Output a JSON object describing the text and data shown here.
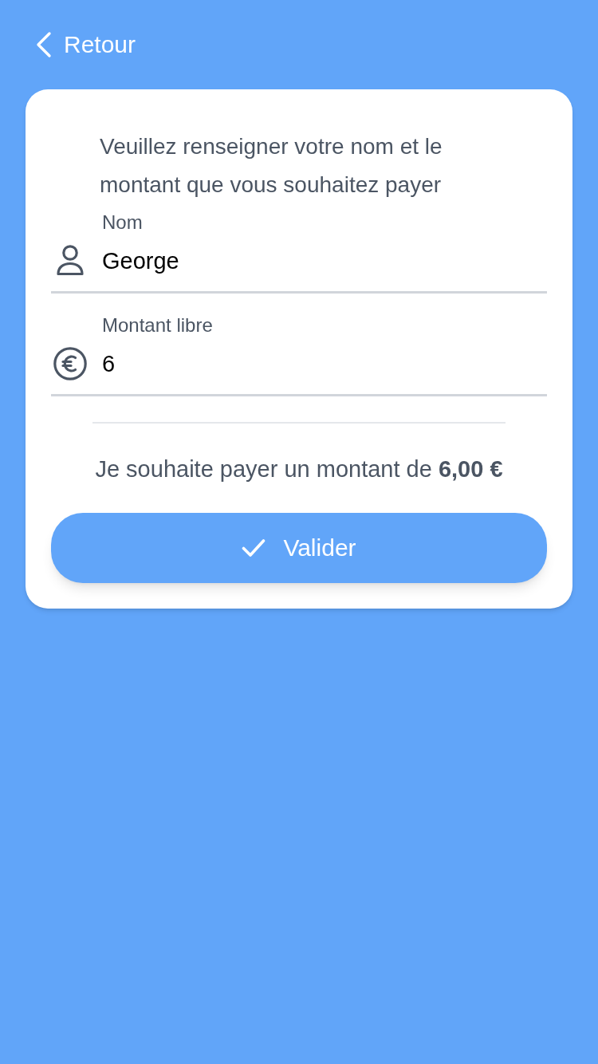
{
  "back": {
    "label": "Retour"
  },
  "intro": "Veuillez renseigner votre nom et le montant que vous souhaitez payer",
  "fields": [
    {
      "kind": "name",
      "label": "Nom",
      "value": "George"
    },
    {
      "kind": "amount",
      "label": "Montant libre",
      "value": "6"
    }
  ],
  "summary": "Je souhaite payer un montant de **6,00 €**",
  "submit": {
    "label": "Valider"
  }
}
